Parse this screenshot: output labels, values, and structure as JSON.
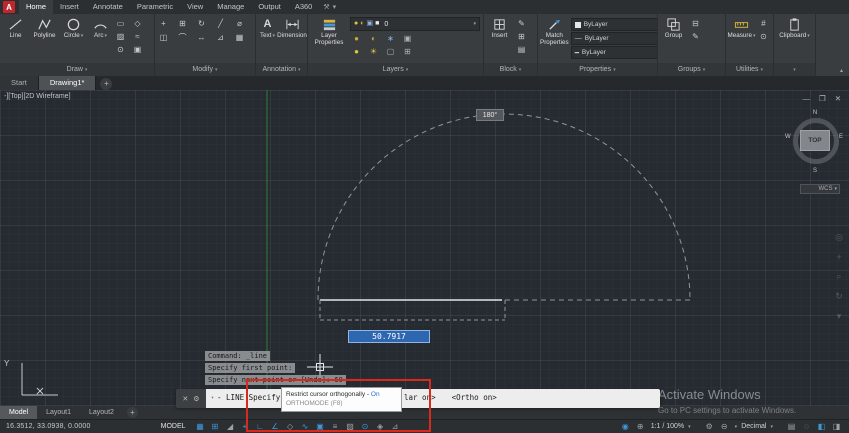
{
  "icons": {
    "caret-down": "▾",
    "close": "✕",
    "customize": "⚙",
    "minimize": "—",
    "restore": "❐",
    "plus": "+",
    "text-tool": "A",
    "linetype": "—",
    "lineweight": "━",
    "collapse": "▴",
    "tools": "⚒"
  },
  "app": {
    "logo_letter": "A",
    "menu_tabs": [
      {
        "name": "tab-home",
        "label": "Home",
        "active": true
      },
      {
        "name": "tab-insert",
        "label": "Insert"
      },
      {
        "name": "tab-annotate",
        "label": "Annotate"
      },
      {
        "name": "tab-parametric",
        "label": "Parametric"
      },
      {
        "name": "tab-view",
        "label": "View"
      },
      {
        "name": "tab-manage",
        "label": "Manage"
      },
      {
        "name": "tab-output",
        "label": "Output"
      },
      {
        "name": "tab-a360",
        "label": "A360"
      }
    ]
  },
  "ribbon": {
    "draw": {
      "label": "Draw",
      "line": "Line",
      "polyline": "Polyline",
      "circle": "Circle",
      "arc": "Arc",
      "small": [
        {
          "name": "rectangle-icon",
          "glyph": "▭"
        },
        {
          "name": "ellipse-icon",
          "glyph": "◇"
        },
        {
          "name": "hatch-icon",
          "glyph": "▨"
        },
        {
          "name": "revision-cloud-icon",
          "glyph": "≈"
        },
        {
          "name": "point-icon",
          "glyph": "⊙"
        },
        {
          "name": "region-icon",
          "glyph": "▣"
        }
      ]
    },
    "modify": {
      "label": "Modify",
      "small": [
        {
          "name": "move-icon",
          "glyph": "+"
        },
        {
          "name": "copy-icon",
          "glyph": "⊞"
        },
        {
          "name": "rotate-icon",
          "glyph": "↻"
        },
        {
          "name": "trim-icon",
          "glyph": "╱"
        },
        {
          "name": "erase-icon",
          "glyph": "⌀"
        },
        {
          "name": "mirror-icon",
          "glyph": "◫"
        },
        {
          "name": "fillet-icon",
          "glyph": "⌒"
        },
        {
          "name": "stretch-icon",
          "glyph": "↔"
        },
        {
          "name": "scale-icon",
          "glyph": "⊿"
        },
        {
          "name": "array-icon",
          "glyph": "▦"
        }
      ]
    },
    "annotation": {
      "label": "Annotation",
      "text": "Text",
      "dimension": "Dimension"
    },
    "layers": {
      "label": "Layers",
      "big_label": "Layer Properties",
      "layer_value": "0",
      "dropdown_icons": [
        {
          "name": "layer-on-icon",
          "glyph": "●",
          "color": "#e3c63f"
        },
        {
          "name": "layer-freeze-icon",
          "glyph": "◐",
          "color": "#e8a33d"
        },
        {
          "name": "layer-lock-icon",
          "glyph": "▣",
          "color": "#8fb4e0"
        },
        {
          "name": "layer-color-swatch",
          "glyph": "■",
          "color": "#e4e6e8"
        }
      ],
      "small": [
        {
          "name": "layer-off-icon",
          "glyph": "●",
          "color": "#caa834"
        },
        {
          "name": "layer-isolate-icon",
          "glyph": "◐",
          "color": "#caa834"
        },
        {
          "name": "layer-freeze-tool-icon",
          "glyph": "∗",
          "color": "#7ab4e8"
        },
        {
          "name": "layer-lock-tool-icon",
          "glyph": "▣",
          "color": "#b0b3b6"
        },
        {
          "name": "layer-on-tool-icon",
          "glyph": "●",
          "color": "#e3c63f"
        },
        {
          "name": "layer-thaw-icon",
          "glyph": "☀",
          "color": "#e3c63f"
        },
        {
          "name": "layer-unlock-icon",
          "glyph": "▢",
          "color": "#b0b3b6"
        },
        {
          "name": "layer-match-icon",
          "glyph": "⊞",
          "color": "#b0b3b6"
        }
      ]
    },
    "block": {
      "label": "Block",
      "big_label": "Insert",
      "small": [
        {
          "name": "edit-attributes-icon",
          "glyph": "✎"
        },
        {
          "name": "create-block-icon",
          "glyph": "⊞"
        },
        {
          "name": "define-attributes-icon",
          "glyph": "▤"
        }
      ]
    },
    "properties": {
      "label": "Properties",
      "big_label": "Match Properties",
      "selects": [
        "ByLayer",
        "ByLayer",
        "ByLayer"
      ]
    },
    "groups": {
      "label": "Groups",
      "big_label": "Group",
      "small": [
        {
          "name": "ungroup-icon",
          "glyph": "⊟"
        },
        {
          "name": "group-edit-icon",
          "glyph": "✎"
        }
      ]
    },
    "utilities": {
      "label": "Utilities",
      "big_label": "Measure",
      "small": [
        {
          "name": "quick-calc-icon",
          "glyph": "#"
        },
        {
          "name": "id-point-icon",
          "glyph": "⊙"
        }
      ]
    },
    "clipboard": {
      "big_label": "Clipboard"
    }
  },
  "file_tabs": {
    "tabs": [
      {
        "name": "file-tab-start",
        "label": "Start"
      },
      {
        "name": "file-tab-drawing1",
        "label": "Drawing1*",
        "active": true
      }
    ]
  },
  "viewport": {
    "label": "-][Top][2D Wireframe]",
    "angle_label": "180°",
    "dyn_input": "50.7917",
    "viewcube": {
      "n": "N",
      "e": "E",
      "s": "S",
      "w": "W",
      "top": "TOP",
      "wcs": "WCS"
    }
  },
  "navbar": {
    "items": [
      {
        "name": "steering-wheel-icon",
        "glyph": "◎"
      },
      {
        "name": "pan-icon",
        "glyph": "+"
      },
      {
        "name": "zoom-icon",
        "glyph": "⌕"
      },
      {
        "name": "orbit-icon",
        "glyph": "↻"
      },
      {
        "name": "navbar-menu-icon",
        "glyph": "▾"
      }
    ]
  },
  "command": {
    "history": [
      {
        "name": "command-history-line",
        "label": "Command: _line",
        "interactable": false
      },
      {
        "name": "command-history-line",
        "label": "Specify first point:",
        "interactable": false
      },
      {
        "name": "command-history-line",
        "label": "Specify next point or [Undo]: 60",
        "interactable": false
      }
    ],
    "prompt_left": "- LINE Specify",
    "prompt_right_1": "lar on>",
    "prompt_right_2": "<Ortho on>"
  },
  "tooltip": {
    "line1": "Restrict cursor orthogonally - ",
    "state": "On",
    "line2": "ORTHOMODE (F8)"
  },
  "status_bar": {
    "coordinates": "16.3512, 33.0938, 0.0000",
    "model_label": "MODEL",
    "scale_label": "1:1 / 100%",
    "units_label": "Decimal",
    "left_icons": [
      {
        "name": "grid-icon",
        "glyph": "▦",
        "color": "#3f97d9"
      },
      {
        "name": "snap-mode-icon",
        "glyph": "⊞",
        "color": "#3f97d9"
      },
      {
        "name": "infer-constraints-icon",
        "glyph": "◢",
        "color": "#9ea1a4"
      },
      {
        "name": "dynamic-input-icon",
        "glyph": "⌖",
        "color": "#3f97d9"
      },
      {
        "name": "ortho-mode-icon",
        "glyph": "∟",
        "color": "#3f97d9"
      },
      {
        "name": "polar-tracking-icon",
        "glyph": "∠",
        "color": "#3f97d9"
      },
      {
        "name": "isometric-drafting-icon",
        "glyph": "◇",
        "color": "#9ea1a4"
      },
      {
        "name": "object-snap-tracking-icon",
        "glyph": "∿",
        "color": "#3f97d9"
      },
      {
        "name": "object-snap-icon",
        "glyph": "▣",
        "color": "#3f97d9"
      },
      {
        "name": "lineweight-icon",
        "glyph": "≡",
        "color": "#9ea1a4"
      },
      {
        "name": "transparency-icon",
        "glyph": "▨",
        "color": "#9ea1a4"
      },
      {
        "name": "selection-cycling-icon",
        "glyph": "⊙",
        "color": "#3f97d9"
      },
      {
        "name": "3d-object-snap-icon",
        "glyph": "◈",
        "color": "#9ea1a4"
      },
      {
        "name": "dynamic-ucs-icon",
        "glyph": "⊿",
        "color": "#9ea1a4"
      }
    ],
    "right_icons_a": [
      {
        "name": "annotation-visibility-icon",
        "glyph": "◉",
        "color": "#3f97d9"
      },
      {
        "name": "autoscale-icon",
        "glyph": "⊕",
        "color": "#9ea1a4"
      }
    ],
    "right_icons_b": [
      {
        "name": "workspace-switching-icon",
        "glyph": "⚙",
        "color": "#9ea1a4"
      },
      {
        "name": "annotation-monitor-icon",
        "glyph": "⊖",
        "color": "#9ea1a4"
      }
    ],
    "right_icons_c": [
      {
        "name": "quick-properties-icon",
        "glyph": "▤",
        "color": "#9ea1a4"
      },
      {
        "name": "isolate-objects-icon",
        "glyph": "◌",
        "color": "#9ea1a4"
      },
      {
        "name": "graphics-performance-icon",
        "glyph": "◧",
        "color": "#3f97d9"
      },
      {
        "name": "clean-screen-icon",
        "glyph": "◨",
        "color": "#9ea1a4"
      }
    ]
  },
  "layout_tabs": {
    "tabs": [
      {
        "name": "layout-tab-model",
        "label": "Model",
        "active": true
      },
      {
        "name": "layout-tab-layout1",
        "label": "Layout1"
      },
      {
        "name": "layout-tab-layout2",
        "label": "Layout2"
      }
    ]
  },
  "watermark": {
    "line1": "Activate Windows",
    "line2": "Go to PC settings to activate Windows."
  }
}
